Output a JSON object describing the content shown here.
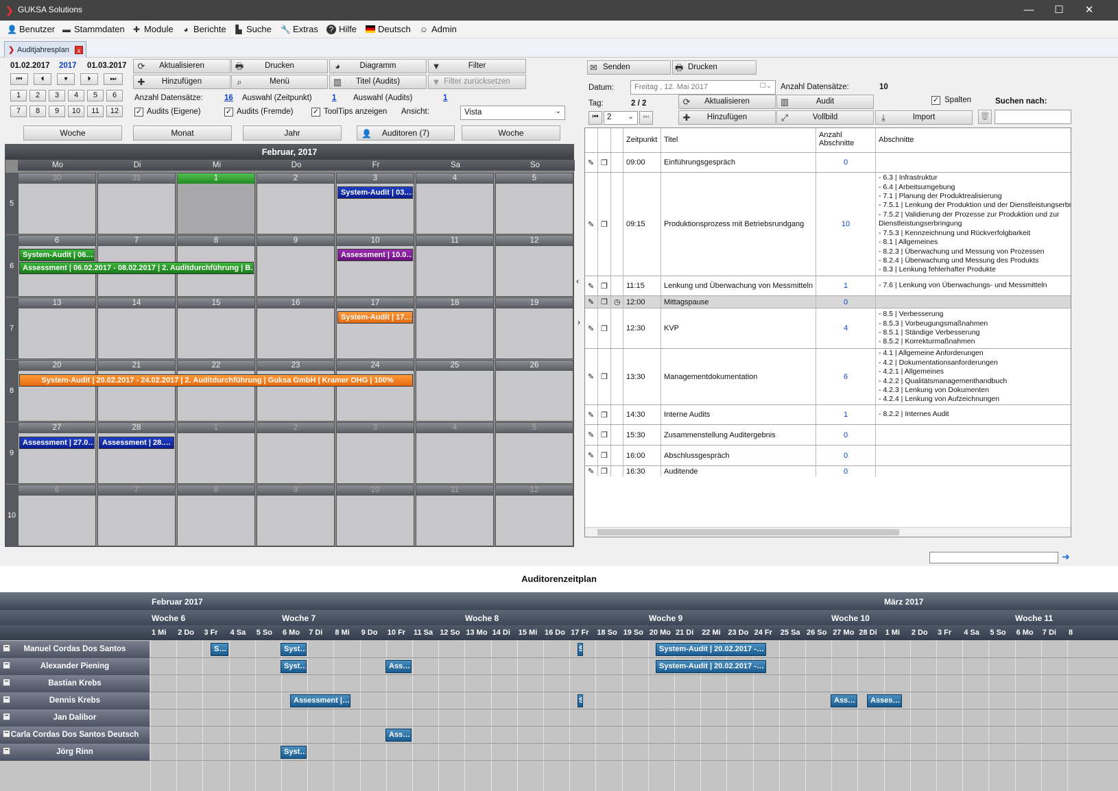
{
  "window": {
    "title": "GUKSA Solutions"
  },
  "menu": [
    {
      "label": "Benutzer",
      "icon": "user-icon"
    },
    {
      "label": "Stammdaten",
      "icon": "folder-icon"
    },
    {
      "label": "Module",
      "icon": "puzzle-icon"
    },
    {
      "label": "Berichte",
      "icon": "pie-icon"
    },
    {
      "label": "Suche",
      "icon": "binoculars-icon"
    },
    {
      "label": "Extras",
      "icon": "wrench-icon"
    },
    {
      "label": "Hilfe",
      "icon": "help-icon"
    },
    {
      "label": "Deutsch",
      "icon": "flag-icon"
    },
    {
      "label": "Admin",
      "icon": "admin-icon"
    }
  ],
  "tab": {
    "label": "Auditjahresplan",
    "close": "x"
  },
  "left": {
    "date_from": "01.02.2017",
    "year": "2017",
    "date_to": "01.03.2017",
    "months": [
      "1",
      "2",
      "3",
      "4",
      "5",
      "6",
      "7",
      "8",
      "9",
      "10",
      "11",
      "12"
    ],
    "buttons": {
      "aktualisieren": "Aktualisieren",
      "drucken": "Drucken",
      "diagramm": "Diagramm",
      "filter": "Filter",
      "hinzufuegen": "Hinzufügen",
      "menu": "Menü",
      "titel": "Titel (Audits)",
      "filter_reset": "Filter zurücksetzen"
    },
    "anzahl_label": "Anzahl Datensätze:",
    "anzahl_val": "16",
    "auswahl_zp_label": "Auswahl (Zeitpunkt)",
    "auswahl_zp_val": "1",
    "auswahl_audits_label": "Auswahl (Audits)",
    "auswahl_audits_val": "1",
    "chk_eigene": "Audits (Eigene)",
    "chk_fremde": "Audits (Fremde)",
    "chk_tooltips": "ToolTips anzeigen",
    "ansicht_label": "Ansicht:",
    "ansicht_val": "Vista",
    "views": [
      "Woche",
      "Monat",
      "Jahr",
      "Auditoren (7)",
      "Woche"
    ]
  },
  "calendar": {
    "month": "Februar, 2017",
    "days": [
      "Mo",
      "Di",
      "Mi",
      "Do",
      "Fr",
      "Sa",
      "So"
    ],
    "weeks": [
      {
        "wk": "5",
        "dates": [
          "30",
          "31",
          "1",
          "2",
          "3",
          "4",
          "5"
        ]
      },
      {
        "wk": "6",
        "dates": [
          "6",
          "7",
          "8",
          "9",
          "10",
          "11",
          "12"
        ]
      },
      {
        "wk": "7",
        "dates": [
          "13",
          "14",
          "15",
          "16",
          "17",
          "18",
          "19"
        ]
      },
      {
        "wk": "8",
        "dates": [
          "20",
          "21",
          "22",
          "23",
          "24",
          "25",
          "26"
        ]
      },
      {
        "wk": "9",
        "dates": [
          "27",
          "28",
          "1",
          "2",
          "3",
          "4",
          "5"
        ]
      },
      {
        "wk": "10",
        "dates": [
          "6",
          "7",
          "8",
          "9",
          "10",
          "11",
          "12"
        ]
      }
    ],
    "events": [
      {
        "text": "System-Audit | 03.…",
        "color": "blue"
      },
      {
        "text": "System-Audit | 06.…",
        "color": "green"
      },
      {
        "text": "Assessment | 06.02.2017 - 08.02.2017 | 2. Auditdurchführung | B…",
        "color": "green"
      },
      {
        "text": "Assessment | 10.0…",
        "color": "purple"
      },
      {
        "text": "System-Audit | 17.…",
        "color": "orange"
      },
      {
        "text": "System-Audit | 20.02.2017 - 24.02.2017 | 2. Auditdurchführung | Guksa GmbH | Kramer OHG | 100%",
        "color": "orange"
      },
      {
        "text": "Assessment | 27.0…",
        "color": "blue"
      },
      {
        "text": "Assessment | 28.…",
        "color": "blue"
      }
    ]
  },
  "right": {
    "senden": "Senden",
    "drucken": "Drucken",
    "datum_label": "Datum:",
    "datum_val": "Freitag   , 12.      Mai      2017",
    "anzahl_label": "Anzahl Datensätze:",
    "anzahl_val": "10",
    "tag_label": "Tag:",
    "tag_val": "2 / 2",
    "tag_sel": "2",
    "aktualisieren": "Aktualisieren",
    "audit": "Audit",
    "hinzufuegen": "Hinzufügen",
    "vollbild": "Vollbild",
    "import": "Import",
    "spalten": "Spalten",
    "suchen_label": "Suchen nach:",
    "cols": [
      "Zeitpunkt",
      "Titel",
      "Anzahl Abschnitte",
      "Abschnitte"
    ],
    "rows": [
      {
        "time": "09:00",
        "title": "Einführungsgespräch",
        "count": "0",
        "sections": []
      },
      {
        "time": "09:15",
        "title": "Produktionsprozess mit Betriebsrundgang",
        "count": "10",
        "sections": [
          "- 6.3 | Infrastruktur",
          "- 6.4 | Arbeitsumgebung",
          "- 7.1 | Planung der Produktrealisierung",
          "- 7.5.1 | Lenkung der Produktion und der Dienstleistungserbri",
          "- 7.5.2 | Validierung der Prozesse zur Produktion und zur",
          "Dienstleistungserbringung",
          "- 7.5.3 | Kennzeichnung und Rückverfolgbarkeit",
          "- 8.1 | Allgemeines",
          "- 8.2.3 | Überwachung und Messung von Prozessen",
          "- 8.2.4 | Überwachung und Messung des Produkts",
          "- 8.3 | Lenkung fehlerhafter Produkte"
        ]
      },
      {
        "time": "11:15",
        "title": "Lenkung und Überwachung von Messmitteln",
        "count": "1",
        "sections": [
          "- 7.6 | Lenkung von Überwachungs- und Messmitteln"
        ]
      },
      {
        "time": "12:00",
        "title": "Mittagspause",
        "count": "0",
        "sections": []
      },
      {
        "time": "12:30",
        "title": "KVP",
        "count": "4",
        "sections": [
          "- 8.5 | Verbesserung",
          "- 8.5.3 | Vorbeugungsmaßnahmen",
          "- 8.5.1 | Ständige Verbesserung",
          "- 8.5.2 | Korrekturmaßnahmen"
        ]
      },
      {
        "time": "13:30",
        "title": "Managementdokumentation",
        "count": "6",
        "sections": [
          "- 4.1 | Allgemeine Anforderungen",
          "- 4.2 | Dokumentationsanforderungen",
          "- 4.2.1 | Allgemeines",
          "- 4.2.2 | Qualitätsmanagementhandbuch",
          "- 4.2.3 | Lenkung von Dokumenten",
          "- 4.2.4 | Lenkung von Aufzeichnungen"
        ]
      },
      {
        "time": "14:30",
        "title": "Interne Audits",
        "count": "1",
        "sections": [
          "- 8.2.2 | Internes Audit"
        ]
      },
      {
        "time": "15:30",
        "title": "Zusammenstellung Auditergebnis",
        "count": "0",
        "sections": []
      },
      {
        "time": "16:00",
        "title": "Abschlussgespräch",
        "count": "0",
        "sections": []
      },
      {
        "time": "16:30",
        "title": "Auditende",
        "count": "0",
        "sections": []
      }
    ]
  },
  "schedule": {
    "title": "Auditorenzeitplan",
    "months": [
      "Februar 2017",
      "März 2017"
    ],
    "weeks": [
      "Woche 6",
      "Woche 7",
      "Woche 8",
      "Woche 9",
      "Woche 10",
      "Woche 11"
    ],
    "days": [
      "1 Mi",
      "2 Do",
      "3 Fr",
      "4 Sa",
      "5 So",
      "6 Mo",
      "7 Di",
      "8 Mi",
      "9 Do",
      "10 Fr",
      "11 Sa",
      "12 So",
      "13 Mo",
      "14 Di",
      "15 Mi",
      "16 Do",
      "17 Fr",
      "18 So",
      "19 So",
      "20 Mo",
      "21 Di",
      "22 Mi",
      "23 Do",
      "24 Fr",
      "25 Sa",
      "26 So",
      "27 Mo",
      "28 Di",
      "1 Mi",
      "2 Do",
      "3 Fr",
      "4 Sa",
      "5 So",
      "6 Mo",
      "7 Di",
      "8"
    ],
    "auditors": [
      {
        "name": "Manuel  Cordas Dos Santos",
        "bars": [
          "S…",
          "Syst…",
          "S",
          "System-Audit | 20.02.2017 -…"
        ]
      },
      {
        "name": "Alexander  Piening",
        "bars": [
          "Syst…",
          "Ass…",
          "System-Audit | 20.02.2017 -…"
        ]
      },
      {
        "name": "Bastian  Krebs",
        "bars": []
      },
      {
        "name": "Dennis  Krebs",
        "bars": [
          "Assessment |…",
          "S",
          "Ass…",
          "Asses…"
        ]
      },
      {
        "name": "Jan  Dalibor",
        "bars": []
      },
      {
        "name": "Carla  Cordas Dos Santos Deutsch",
        "bars": [
          "Ass…"
        ]
      },
      {
        "name": "Jörg  Rinn",
        "bars": [
          "Syst…"
        ]
      }
    ]
  }
}
